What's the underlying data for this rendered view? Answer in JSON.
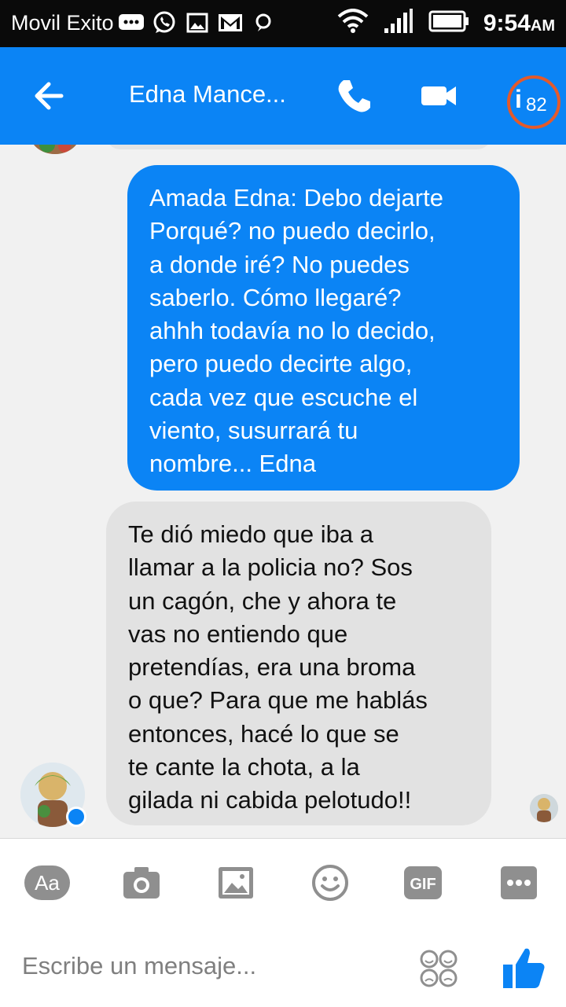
{
  "status_bar": {
    "carrier": "Movil Exito",
    "time": "9:54",
    "am_pm": "AM",
    "icons": [
      "chat-bubbles-icon",
      "whatsapp-icon",
      "image-icon",
      "gmail-icon",
      "message-icon",
      "wifi-icon",
      "signal-icon",
      "battery-icon"
    ]
  },
  "header": {
    "contact_name": "Edna Mance...",
    "notification_count": "82",
    "colors": {
      "bar": "#0b84f5",
      "badge_ring": "#e35a2c"
    }
  },
  "messages": [
    {
      "direction": "sent",
      "lines": [
        "Amada Edna: Debo dejarte",
        "Porqué? no puedo decirlo,",
        "a donde iré? No puedes",
        "saberlo. Cómo llegaré?",
        "ahhh todavía no lo decido,",
        "pero puedo decirte algo,",
        "cada vez que escuche el",
        "viento, susurrará tu",
        "nombre... Edna"
      ]
    },
    {
      "direction": "received",
      "lines": [
        "Te dió miedo que iba a",
        "llamar a la policia no? Sos",
        "un cagón, che y ahora te",
        "vas no entiendo que",
        "pretendías, era una broma",
        "o que? Para que me hablás",
        "entonces, hacé lo que se",
        "te cante la chota, a la",
        "gilada ni cabida pelotudo!!"
      ]
    }
  ],
  "composer": {
    "text_tool_label": "Aa",
    "gif_label": "GIF",
    "placeholder": "Escribe un mensaje...",
    "tool_icons": [
      "text-format-icon",
      "camera-icon",
      "gallery-icon",
      "emoji-icon",
      "gif-icon",
      "more-icon"
    ],
    "colors": {
      "tool_gray": "#8f8f8f",
      "like_blue": "#0b84f5"
    }
  }
}
